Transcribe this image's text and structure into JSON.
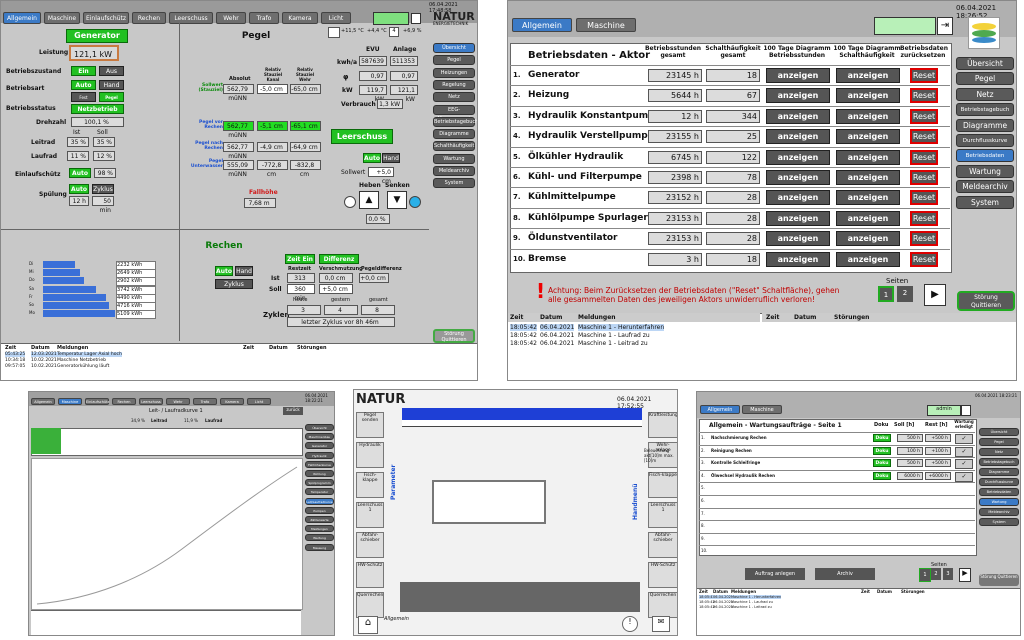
{
  "p1": {
    "tabs": [
      "Allgemein",
      "Maschine",
      "Einlaufschütz",
      "Rechen",
      "Leerschuss",
      "Wehr",
      "Trafo",
      "Kamera",
      "Licht"
    ],
    "datetime": "06.04.2021 17:48:58",
    "logo": "NATUR",
    "logo_sub": "ENERGIETECHNIK",
    "gen": {
      "title": "Generator",
      "leistung_lbl": "Leistung",
      "leistung": "121,1 kW",
      "bz_lbl": "Betriebszustand",
      "ein": "Ein",
      "aus": "Aus",
      "ba_lbl": "Betriebsart",
      "auto": "Auto",
      "hand": "Hand",
      "fest": "Fest sollwert",
      "pegel": "Pegel regelung",
      "bs_lbl": "Betriebsstatus",
      "netzbetrieb": "Netzbetrieb",
      "dz_lbl": "Drehzahl",
      "dz": "100,1 %",
      "ist": "Ist",
      "soll": "Soll",
      "leitrad": "Leitrad",
      "leitrad_ist": "35 %",
      "leitrad_soll": "35 %",
      "laufrad": "Laufrad",
      "laufrad_ist": "11 %",
      "laufrad_soll": "12 %",
      "einlauf": "Einlaufschütz",
      "einlauf_auto": "Auto",
      "einlauf_val": "98 %",
      "spuelung": "Spülung",
      "auto2": "Auto",
      "zyklus": "Zyklus",
      "h12": "12 h",
      "m50": "50 min"
    },
    "pegel": {
      "title": "Pegel",
      "h_abs": "Absolut",
      "h_rel_stau": "Relativ Stauziel Kanal",
      "h_rel_wehr": "Relativ Stauziel Wehr",
      "sollwert": "Sollwert (Stauziel)",
      "r1": [
        "562,79 müNN",
        "-5,0 cm",
        "-65,0 cm"
      ],
      "vor": "Pegel vor Rechen",
      "r2": [
        "562,77 müNN",
        "-5,1 cm",
        "-65,1 cm"
      ],
      "nach": "Pegel nach Rechen",
      "r3": [
        "562,77 müNN",
        "-4,9 cm",
        "-64,9 cm"
      ],
      "unter": "Pegel Unterwasser",
      "r4": [
        "555,09 müNN",
        "-772,8 cm",
        "-832,8 cm"
      ],
      "fall_lbl": "Fallhöhe",
      "fall": "7,68 m"
    },
    "evu": {
      "temp": "+11,5 °C",
      "temp2": "+4,4 °C",
      "num": "4",
      "ms": "+6,9 %",
      "hevu": "EVU",
      "hanl": "Anlage",
      "kwha": "kwh/a",
      "kwha_evu": "587639",
      "kwha_anl": "511353",
      "phi": "φ",
      "phi_evu": "0,97",
      "phi_anl": "0,97",
      "kw": "kW",
      "kw_evu": "119,7 kW",
      "kw_anl": "121,1 kW",
      "verb": "Verbrauch",
      "verb_val": "1,3 kW"
    },
    "leer": {
      "title": "Leerschuss",
      "auto": "Auto",
      "hand": "Hand",
      "soll_lbl": "Sollwert",
      "soll": "+5,0 cm",
      "heben": "Heben",
      "senken": "Senken",
      "pct": "0,0 %"
    },
    "side": [
      "Übersicht",
      "Pegel",
      "Heizungen",
      "Regelung",
      "Netz",
      "EEG-Management",
      "Betriebstagebuch",
      "Diagramme",
      "Schalthäufigkeit",
      "Wartung",
      "Meldearchiv",
      "System",
      "Störung Quittieren"
    ],
    "energy": {
      "rows": [
        {
          "d": "Di",
          "v": "2232 kWh",
          "f": 0.44
        },
        {
          "d": "Mi",
          "v": "2649 kWh",
          "f": 0.52
        },
        {
          "d": "Do",
          "v": "2902 kWh",
          "f": 0.57
        },
        {
          "d": "Sa",
          "v": "3742 kWh",
          "f": 0.73
        },
        {
          "d": "Fr",
          "v": "4490 kWh",
          "f": 0.88
        },
        {
          "d": "So",
          "v": "4716 kWh",
          "f": 0.92
        },
        {
          "d": "Mo",
          "v": "5109 kWh",
          "f": 1.0
        }
      ]
    },
    "rechen": {
      "title": "Rechen",
      "zeit": "Zeit Ein",
      "diff": "Differenz Ein",
      "auto": "Auto",
      "hand": "Hand",
      "zyklus": "Zyklus",
      "h_rz": "Restzeit",
      "h_vs": "Verschmutzung",
      "h_pd": "Pegeldifferenz",
      "ist": "Ist",
      "ist_rz": "313 min",
      "ist_vs": "0,0 cm",
      "ist_pd": "+0,0 cm",
      "soll": "Soll",
      "soll_rz": "360 min",
      "soll_vs": "+5,0 cm",
      "zyk": "Zyklen",
      "h_heute": "heute",
      "h_gest": "gestern",
      "h_ges": "gesamt",
      "v_heute": "3",
      "v_gest": "4",
      "v_ges": "8",
      "letzter": "letzter Zyklus vor  8h  46m"
    },
    "log": {
      "h": [
        "Zeit",
        "Datum",
        "Meldungen"
      ],
      "rows": [
        [
          "05:43:25",
          "12.03.2021",
          "Temperatur Lager Axial hoch"
        ],
        [
          "10:34:18",
          "10.02.2021",
          "Maschine Netzbetrieb"
        ],
        [
          "09:57:05",
          "10.02.2021",
          "Generatorkühlung läuft"
        ]
      ],
      "h2": [
        "Zeit",
        "Datum",
        "Störungen"
      ]
    }
  },
  "p2": {
    "tab1": "Allgemein",
    "tab2": "Maschine",
    "datetime": "06.04.2021 18:26:52",
    "h": [
      "Betriebsdaten - Aktor",
      "Betriebsstunden gesamt",
      "Schalthäufigkeit gesamt",
      "100 Tage Diagramm Betriebsstunden",
      "100 Tage Diagramm Schalthäufigkeit",
      "Betriebsdaten zurücksetzen"
    ],
    "rows": [
      {
        "n": "1.",
        "name": "Generator",
        "h": "23145 h",
        "s": "18"
      },
      {
        "n": "2.",
        "name": "Heizung",
        "h": "5644 h",
        "s": "67"
      },
      {
        "n": "3.",
        "name": "Hydraulik Konstantpumpe",
        "h": "12 h",
        "s": "344"
      },
      {
        "n": "4.",
        "name": "Hydraulik Verstellpumpe",
        "h": "23155 h",
        "s": "25"
      },
      {
        "n": "5.",
        "name": "Ölkühler Hydraulik",
        "h": "6745 h",
        "s": "122"
      },
      {
        "n": "6.",
        "name": "Kühl- und Filterpumpe",
        "h": "2398 h",
        "s": "78"
      },
      {
        "n": "7.",
        "name": "Kühlmittelpumpe",
        "h": "23152 h",
        "s": "28"
      },
      {
        "n": "8.",
        "name": "Kühlölpumpe Spurlager",
        "h": "23153 h",
        "s": "28"
      },
      {
        "n": "9.",
        "name": "Öldunstventilator",
        "h": "23153 h",
        "s": "28"
      },
      {
        "n": "10.",
        "name": "Bremse",
        "h": "3 h",
        "s": "18"
      }
    ],
    "anzeigen": "anzeigen",
    "reset": "Reset",
    "seiten": "Seiten",
    "p1": "1",
    "p2": "2",
    "warn": "Achtung: Beim Zurücksetzen der Betriebsdaten (\"Reset\" Schaltfläche), gehen alle gesammelten Daten des jeweiligen Aktors unwiderruflich verloren!",
    "side": [
      "Übersicht",
      "Pegel",
      "Netz",
      "Betriebstagebuch",
      "Diagramme",
      "Durchflusskurve",
      "Betriebsdaten",
      "Wartung",
      "Meldearchiv",
      "System"
    ],
    "stoer": "Störung Quittieren",
    "log_h": [
      "Zeit",
      "Datum",
      "Meldungen"
    ],
    "log": [
      [
        "18:05:42",
        "06.04.2021",
        "Maschine 1 - Herunterfahren"
      ],
      [
        "18:05:42",
        "06.04.2021",
        "Maschine 1 - Laufrad zu"
      ],
      [
        "18:05:42",
        "06.04.2021",
        "Maschine 1 - Leitrad zu"
      ]
    ],
    "log2_h": [
      "Zeit",
      "Datum",
      "Störungen"
    ]
  },
  "p3": {
    "tabs": [
      "Allgemein",
      "Maschine",
      "Einlaufschütz",
      "Rechen",
      "Leerschuss",
      "Wehr",
      "Trafo",
      "Kamera",
      "Licht"
    ],
    "datetime": "06.04.2021 18:22:21",
    "title": "Leit- / Laufradkurve 1",
    "zurueck": "zurück",
    "leitrad": "Leitrad",
    "laufrad": "Laufrad",
    "v1": "34,9 %",
    "v2": "11,9 %",
    "side": [
      "Übersicht",
      "Maschinenbau",
      "Generator",
      "Hydraulik",
      "Fallhöhenkurve",
      "Rühlung",
      "Spülprogramm",
      "Temperatur",
      "Leit/Laufradkurve",
      "Pumpen",
      "Zählerwerte",
      "Meldungen",
      "Wartung",
      "Messung"
    ]
  },
  "p4": {
    "logo": "NATUR",
    "datetime": "06.04.2021 17:52:55",
    "left": [
      "Pegel senden",
      "Hydraulik",
      "Fisch-klappe",
      "Leerschuss 1",
      "Abfahr-schieber",
      "HW-Schütz",
      "Querrechen"
    ],
    "right": [
      "Kraftleistung",
      "Wehr-anlage",
      "Fisch-klappe",
      "Leerschuss 1",
      "Abfahr-schieber",
      "HW-Schütz",
      "Querrechen"
    ],
    "param": "Parameter",
    "hand": "Handmenü",
    "allgemein": "Allgemein",
    "info": "Beleuchtung akt[10]m max.[10]m"
  },
  "p5": {
    "tab1": "Allgemein",
    "tab2": "Maschine",
    "datetime": "06.04.2021 18:23:21",
    "admin": "admin",
    "title": "Allgemein - Wartungsaufträge - Seite 1",
    "h": [
      "Doku",
      "Soll [h]",
      "Rest [h]",
      "Wartung erledigt"
    ],
    "rows": [
      {
        "n": "1.",
        "t": "Nachschmierung Rechen",
        "soll": "500 h",
        "rest": "+500 h"
      },
      {
        "n": "2.",
        "t": "Reinigung Rechen",
        "soll": "100 h",
        "rest": "+100 h"
      },
      {
        "n": "3.",
        "t": "Kontrolle Schleifringe",
        "soll": "500 h",
        "rest": "+500 h"
      },
      {
        "n": "4.",
        "t": "Ölwechsel Hydraulik Rechen",
        "soll": "6000 h",
        "rest": "+6000 h"
      }
    ],
    "empty": [
      "5.",
      "6.",
      "7.",
      "8.",
      "9.",
      "10."
    ],
    "doku": "Doku",
    "anlegen": "Auftrag anlegen",
    "archiv": "Archiv",
    "seiten": "Seiten",
    "pages": [
      "1",
      "2",
      "3"
    ],
    "side": [
      "Übersicht",
      "Pegel",
      "Netz",
      "Betriebstagebuch",
      "Diagramme",
      "Durchflusskurve",
      "Betriebsdaten",
      "Wartung",
      "Meldearchiv",
      "System"
    ],
    "stoer": "Störung Quittieren",
    "log": [
      [
        "18:05:42",
        "06.04.2021",
        "Maschine 1 - Herunterfahren"
      ],
      [
        "18:05:42",
        "06.04.2021",
        "Maschine 1 - Laufrad zu"
      ],
      [
        "18:05:42",
        "06.04.2021",
        "Maschine 1 - Leitrad zu"
      ]
    ],
    "log_h": [
      "Zeit",
      "Datum",
      "Meldungen"
    ],
    "log2_h": [
      "Zeit",
      "Datum",
      "Störungen"
    ]
  }
}
